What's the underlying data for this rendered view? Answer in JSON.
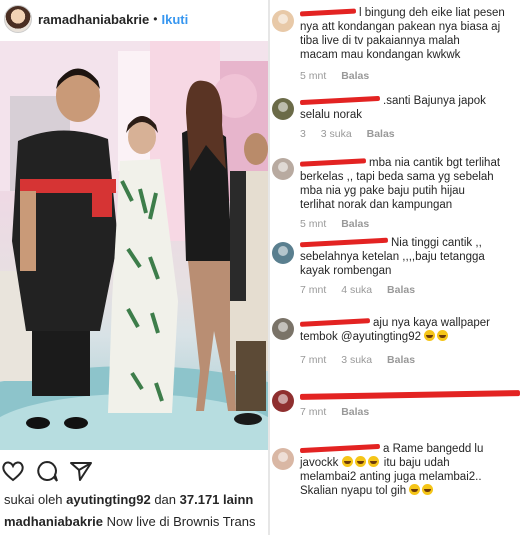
{
  "post": {
    "username": "ramadhaniabakrie",
    "separator": "•",
    "follow_label": "Ikuti",
    "likes_prefix": "sukai oleh",
    "likes_user": "ayutingting92",
    "likes_mid": "dan",
    "likes_count": "37.171 lainn",
    "caption_user": "madhaniabakrie",
    "caption_text": "Now live di Brownis Trans",
    "icons": [
      "heart-icon",
      "comment-icon",
      "share-icon"
    ]
  },
  "comments": [
    {
      "avatar_color": "#e8c9a8",
      "lines": [
        "l bingung deh eike liat pesen",
        "nya att kondangan pakean nya biasa aj",
        "tiba live di tv pakaiannya malah",
        "macam mau kondangan kwkwk"
      ],
      "time": "5 mnt",
      "likes": "",
      "reply": "Balas"
    },
    {
      "avatar_color": "#6b6b48",
      "lines": [
        ".santi Bajunya japok",
        "selalu norak"
      ],
      "time": "3",
      "likes": "3 suka",
      "reply": "Balas"
    },
    {
      "avatar_color": "#b8aaa0",
      "lines": [
        "mba nia cantik bgt terlihat",
        "berkelas ,, tapi beda sama yg sebelah",
        "mba nia yg pake baju putih hijau",
        "terlihat norak dan kampungan"
      ],
      "time": "5 mnt",
      "likes": "",
      "reply": "Balas"
    },
    {
      "avatar_color": "#5a7f8f",
      "lines": [
        "Nia tinggi cantik ,,",
        "sebelahnya ketelan ,,,,baju tetangga",
        "kayak  rombengan"
      ],
      "time": "7 mnt",
      "likes": "4 suka",
      "reply": "Balas"
    },
    {
      "avatar_color": "#7a7368",
      "lines": [
        "aju nya kaya wallpaper",
        "tembok @ayutingting92"
      ],
      "time": "7 mnt",
      "likes": "3 suka",
      "reply": "Balas"
    },
    {
      "avatar_color": "#8f2f2f",
      "lines": [
        ""
      ],
      "time": "7 mnt",
      "likes": "",
      "reply": "Balas"
    },
    {
      "avatar_color": "#d9b7a4",
      "lines": [
        "a Rame bangedd lu",
        "javockk",
        "itu baju udah",
        "melambai2 anting juga melambai2..",
        "Skalian nyapu tol gih"
      ],
      "time": "",
      "likes": "",
      "reply": ""
    }
  ]
}
